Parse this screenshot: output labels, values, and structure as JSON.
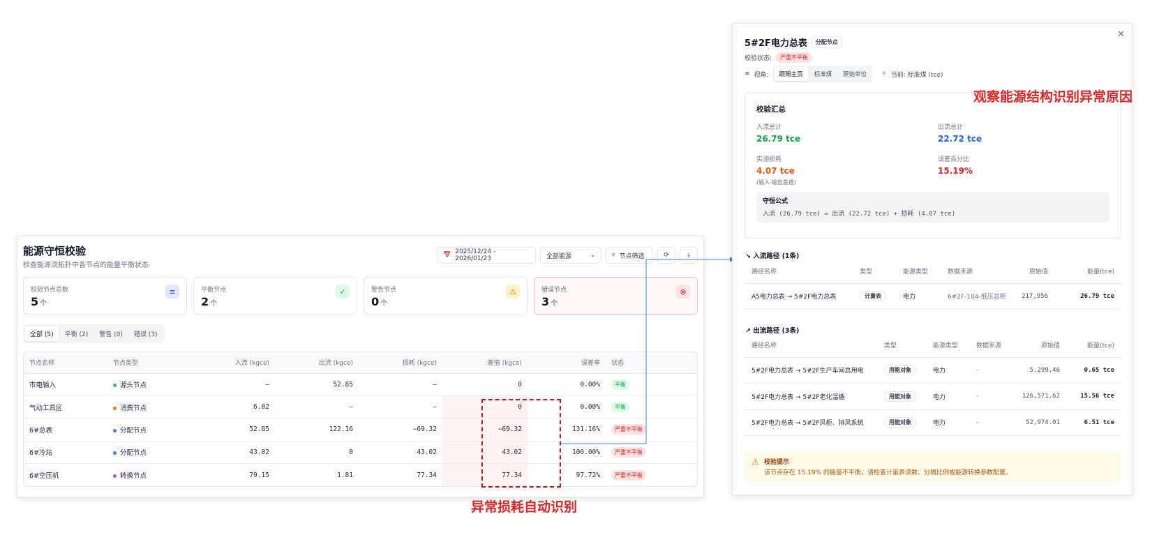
{
  "main": {
    "title": "能源守恒校验",
    "subtitle": "检查能源流拓扑中各节点的能量平衡状态",
    "date_range": "2025/12/24 - 2026/01/23",
    "energy_select": "全部能源",
    "filter_label": "节点筛选",
    "stats": [
      {
        "label": "校验节点总数",
        "value": "5",
        "unit": "个"
      },
      {
        "label": "平衡节点",
        "value": "2",
        "unit": "个"
      },
      {
        "label": "警告节点",
        "value": "0",
        "unit": "个"
      },
      {
        "label": "错误节点",
        "value": "3",
        "unit": "个"
      }
    ],
    "tabs": [
      "全部 (5)",
      "平衡 (2)",
      "警告 (0)",
      "错误 (3)"
    ],
    "columns": [
      "节点名称",
      "节点类型",
      "入流 (kgce)",
      "出流 (kgce)",
      "损耗 (kgce)",
      "差值 (kgce)",
      "误差率",
      "状态"
    ],
    "rows": [
      {
        "name": "市电输入",
        "type": "源头节点",
        "type_color": "#22c55e",
        "in": "–",
        "out": "52.85",
        "loss": "–",
        "diff": "0",
        "rate": "0.00%",
        "status": "平衡",
        "ok": true
      },
      {
        "name": "气动工具区",
        "type": "消费节点",
        "type_color": "#f97316",
        "in": "6.02",
        "out": "–",
        "loss": "–",
        "diff": "0",
        "rate": "0.00%",
        "status": "平衡",
        "ok": true
      },
      {
        "name": "6#总表",
        "type": "分配节点",
        "type_color": "#3b82f6",
        "in": "52.85",
        "out": "122.16",
        "loss": "−69.32",
        "diff": "−69.32",
        "rate": "131.16%",
        "status": "严重不平衡",
        "ok": false
      },
      {
        "name": "6#冷站",
        "type": "分配节点",
        "type_color": "#3b82f6",
        "in": "43.02",
        "out": "0",
        "loss": "43.02",
        "diff": "43.02",
        "rate": "100.00%",
        "status": "严重不平衡",
        "ok": false
      },
      {
        "name": "6#空压机",
        "type": "转换节点",
        "type_color": "#8b5cf6",
        "in": "79.15",
        "out": "1.81",
        "loss": "77.34",
        "diff": "77.34",
        "rate": "97.72%",
        "status": "严重不平衡",
        "ok": false
      }
    ]
  },
  "annotations": {
    "left": "异常损耗自动识别",
    "right": "观察能源结构识别异常原因"
  },
  "detail": {
    "title": "5#2F电力总表",
    "node_tag": "分配节点",
    "status_label": "校验状态:",
    "status_value": "严重不平衡",
    "view_label": "视角:",
    "view_options": [
      "跟随主页",
      "标准煤",
      "原始单位"
    ],
    "current_label": "当前: 标准煤 (tce)",
    "summary_title": "校验汇总",
    "in_label": "入流总计",
    "in_value": "26.79 tce",
    "out_label": "出流总计",
    "out_value": "22.72 tce",
    "loss_label": "实测损耗",
    "loss_value": "4.07 tce",
    "loss_note": "(输入-输出差值)",
    "err_label": "误差百分比",
    "err_value": "15.19%",
    "formula_title": "守恒公式",
    "formula_text": "入流 (26.79 tce) = 出流 (22.72 tce) + 损耗 (4.07 tce)",
    "in_path_title": "入流路径 (1条)",
    "out_path_title": "出流路径 (3条)",
    "path_columns": [
      "路径名称",
      "类型",
      "能源类型",
      "数据来源",
      "原始值",
      "能量(tce)"
    ],
    "in_paths": [
      {
        "name": "A5电力总表 → 5#2F电力总表",
        "type": "计量表",
        "energy": "电力",
        "source": "6#2F-104-低压总柜",
        "raw": "217,956",
        "tce": "26.79 tce"
      }
    ],
    "out_paths": [
      {
        "name": "5#2F电力总表 → 5#2F生产车间总用电",
        "type": "用能对象",
        "energy": "电力",
        "source": "-",
        "raw": "5,299.46",
        "tce": "0.65 tce"
      },
      {
        "name": "5#2F电力总表 → 5#2F老化温循",
        "type": "用能对象",
        "energy": "电力",
        "source": "-",
        "raw": "126,571.62",
        "tce": "15.56 tce"
      },
      {
        "name": "5#2F电力总表 → 5#2F风柜、排风系统",
        "type": "用能对象",
        "energy": "电力",
        "source": "-",
        "raw": "52,974.01",
        "tce": "6.51 tce"
      }
    ],
    "hint_title": "校验提示",
    "hint_text": "该节点存在 15.19% 的能量不平衡，请检查计量表读数、分摊比例或能源转换参数配置。"
  },
  "colors": {
    "green": "#16a34a",
    "blue": "#2563eb",
    "orange": "#ea580c",
    "red": "#dc2626",
    "annotation": "#dc2626"
  },
  "icons": [
    "calendar-icon",
    "chevron-down-icon",
    "filter-icon",
    "refresh-icon",
    "download-icon",
    "layers-icon",
    "check-circle-icon",
    "warning-icon",
    "x-circle-icon",
    "close-icon",
    "arrow-in-icon",
    "arrow-out-icon"
  ]
}
